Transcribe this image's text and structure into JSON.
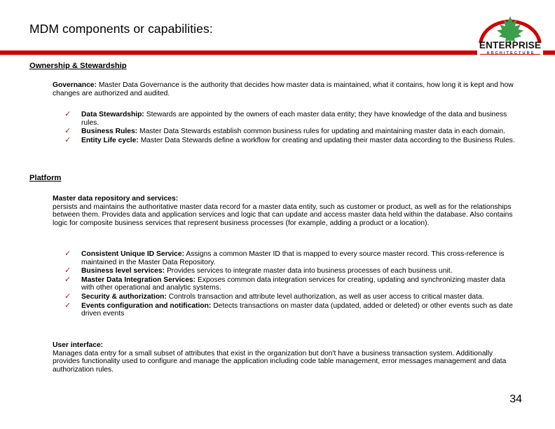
{
  "slide": {
    "title": "MDM components or capabilities:",
    "page_number": "34",
    "accent_color": "#cc0000",
    "bullet_color": "#8c2b2b"
  },
  "logo": {
    "name": "ENTERPRISE",
    "subtitle": "ARCHITECTURE",
    "leaf_icon": "maple-leaf-icon",
    "leaf_color": "#3a9e4a",
    "arc_color": "#cc0000"
  },
  "sections": {
    "ownership": {
      "heading": "Ownership & Stewardship",
      "intro_lead": "Governance:",
      "intro_text": " Master Data Governance is the authority that decides how master data is maintained, what it contains, how long it is kept and how changes are authorized and audited.",
      "items": [
        {
          "lead": "Data Stewardship:",
          "text": " Stewards are appointed by the owners of each master data entity; they have knowledge of the data and business rules."
        },
        {
          "lead": "Business Rules:",
          "text": " Master Data Stewards establish common business rules for updating and maintaining master data in each domain."
        },
        {
          "lead": "Entity Life cycle:",
          "text": " Master Data Stewards define a workflow for creating and updating their master data according to the Business Rules."
        }
      ]
    },
    "platform": {
      "heading": "Platform",
      "repository_lead": "Master data repository and services:",
      "repository_text": "persists and maintains the authoritative master data record for a master data entity, such as customer or product, as well as for the relationships between them.  Provides data and application services and logic that can update and access master data held within the database. Also contains logic for composite business services that represent business processes (for example, adding a product or a location).",
      "items": [
        {
          "lead": "Consistent Unique ID Service:",
          "text": " Assigns a common Master ID that is mapped to every source master record. This cross-reference is maintained in the Master Data Repository."
        },
        {
          "lead": " Business level services:",
          "text": " Provides services to integrate master data into business processes of each business unit."
        },
        {
          "lead": "Master Data Integration Services:",
          "text": " Exposes common data integration services for creating, updating and synchronizing master data with other operational and analytic systems."
        },
        {
          "lead": "Security & authorization:",
          "text": " Controls transaction and attribute level authorization, as well as user access to critical master data."
        },
        {
          "lead": "Events configuration and notification:",
          "text": " Detects transactions on master data (updated, added or deleted) or other events such as date driven events"
        }
      ],
      "ui_lead": "User interface:",
      "ui_text": "Manages data entry for a small subset of attributes that exist in the organization but don't have a business transaction system. Additionally provides functionality used to configure and manage the application including code table management, error messages management  and data authorization rules."
    }
  }
}
